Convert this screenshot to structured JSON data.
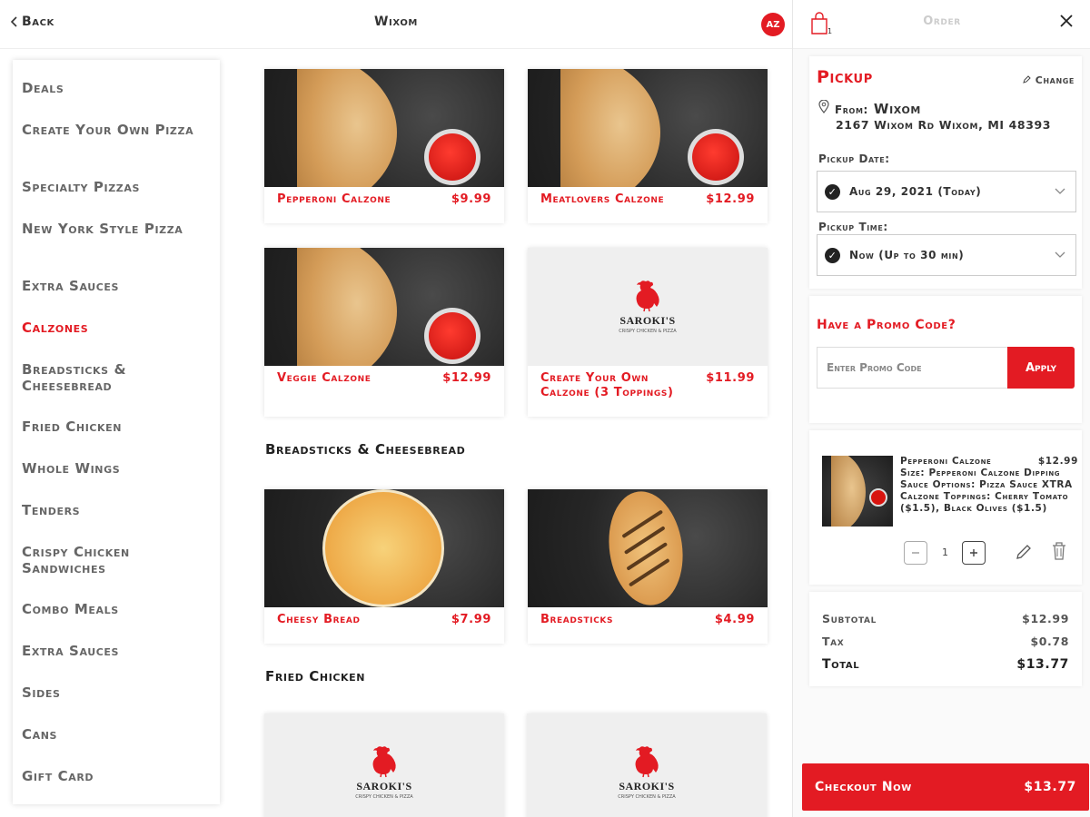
{
  "header": {
    "back_label": "Back",
    "store_title": "Wixom",
    "avatar_initials": "AZ"
  },
  "sidebar": {
    "items": [
      {
        "label": "Deals",
        "active": false
      },
      {
        "label": "Create Your Own Pizza",
        "active": false
      },
      {
        "label": "Specialty Pizzas",
        "active": false
      },
      {
        "label": "New York Style Pizza",
        "active": false
      },
      {
        "label": "Extra Sauces",
        "active": false
      },
      {
        "label": "Calzones",
        "active": true
      },
      {
        "label": "Breadsticks & Cheesebread",
        "active": false
      },
      {
        "label": "Fried Chicken",
        "active": false
      },
      {
        "label": "Whole Wings",
        "active": false
      },
      {
        "label": "Tenders",
        "active": false
      },
      {
        "label": "Crispy Chicken Sandwiches",
        "active": false
      },
      {
        "label": "Combo Meals",
        "active": false
      },
      {
        "label": "Extra Sauces",
        "active": false
      },
      {
        "label": "Sides",
        "active": false
      },
      {
        "label": "Cans",
        "active": false
      },
      {
        "label": "Gift Card",
        "active": false
      }
    ]
  },
  "menu": {
    "calzones": [
      {
        "name": "Pepperoni Calzone",
        "price": "$9.99",
        "image": "calzone-photo"
      },
      {
        "name": "Meatlovers Calzone",
        "price": "$12.99",
        "image": "calzone-photo"
      },
      {
        "name": "Veggie Calzone",
        "price": "$12.99",
        "image": "calzone-photo"
      },
      {
        "name": "Create Your Own Calzone (3 Toppings)",
        "price": "$11.99",
        "image": "saroki-logo"
      }
    ],
    "breadsticks_title": "Breadsticks & Cheesebread",
    "breadsticks": [
      {
        "name": "Cheesy Bread",
        "price": "$7.99",
        "image": "cheesy-bread-photo"
      },
      {
        "name": "Breadsticks",
        "price": "$4.99",
        "image": "breadsticks-photo"
      }
    ],
    "fried_chicken_title": "Fried Chicken",
    "fried_chicken": [
      {
        "image": "saroki-logo"
      },
      {
        "image": "saroki-logo"
      }
    ],
    "logo_text": "SAROKI'S",
    "logo_sub": "CRISPY CHICKEN & PIZZA"
  },
  "order": {
    "title": "Order",
    "bag_count": "1",
    "mode": "Pickup",
    "change_label": "Change",
    "from_label": "From:",
    "store_name": "Wixom",
    "address": "2167 Wixom Rd Wixom, MI 48393",
    "date_label": "Pickup Date:",
    "date_value": "Aug 29, 2021 (Today)",
    "time_label": "Pickup Time:",
    "time_value": "Now (Up to 30 min)",
    "promo_title": "Have a Promo Code?",
    "promo_placeholder": "Enter Promo Code",
    "apply_label": "Apply",
    "item": {
      "name": "Pepperoni Calzone",
      "price": "$12.99",
      "details": "Size: Pepperoni Calzone Dipping Sauce Options: Pizza Sauce XTRA Calzone Toppings: Cherry Tomato ($1.5), Black Olives ($1.5)",
      "quantity": "1"
    },
    "subtotal_label": "Subtotal",
    "subtotal": "$12.99",
    "tax_label": "Tax",
    "tax": "$0.78",
    "total_label": "Total",
    "total": "$13.77",
    "checkout_label": "Checkout Now",
    "checkout_amount": "$13.77"
  },
  "colors": {
    "accent": "#e31b23",
    "text": "#222222",
    "muted": "#666666"
  }
}
